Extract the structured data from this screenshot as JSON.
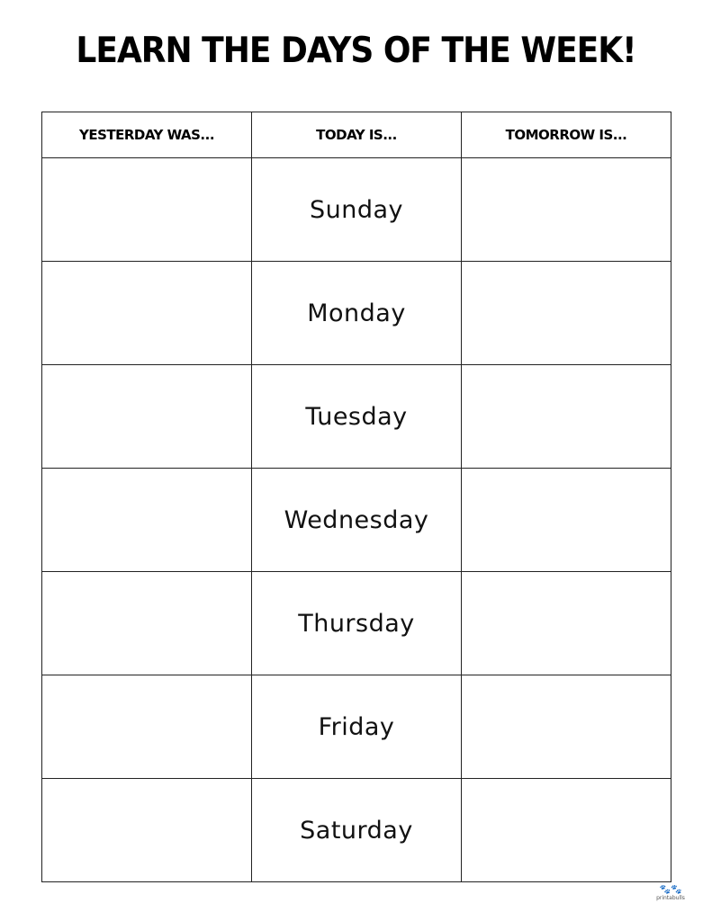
{
  "title": "LEARN THE DAYS OF THE WEEK!",
  "table": {
    "headers": [
      "YESTERDAY WAS...",
      "TODAY IS...",
      "TOMORROW IS..."
    ],
    "rows": [
      {
        "yesterday": "",
        "today": "Sunday",
        "tomorrow": ""
      },
      {
        "yesterday": "",
        "today": "Monday",
        "tomorrow": ""
      },
      {
        "yesterday": "",
        "today": "Tuesday",
        "tomorrow": ""
      },
      {
        "yesterday": "",
        "today": "Wednesday",
        "tomorrow": ""
      },
      {
        "yesterday": "",
        "today": "Thursday",
        "tomorrow": ""
      },
      {
        "yesterday": "",
        "today": "Friday",
        "tomorrow": ""
      },
      {
        "yesterday": "",
        "today": "Saturday",
        "tomorrow": ""
      }
    ]
  },
  "logo": {
    "icon": "dogs-icon",
    "glyph": "🐾🐾",
    "text": "printabulls"
  }
}
